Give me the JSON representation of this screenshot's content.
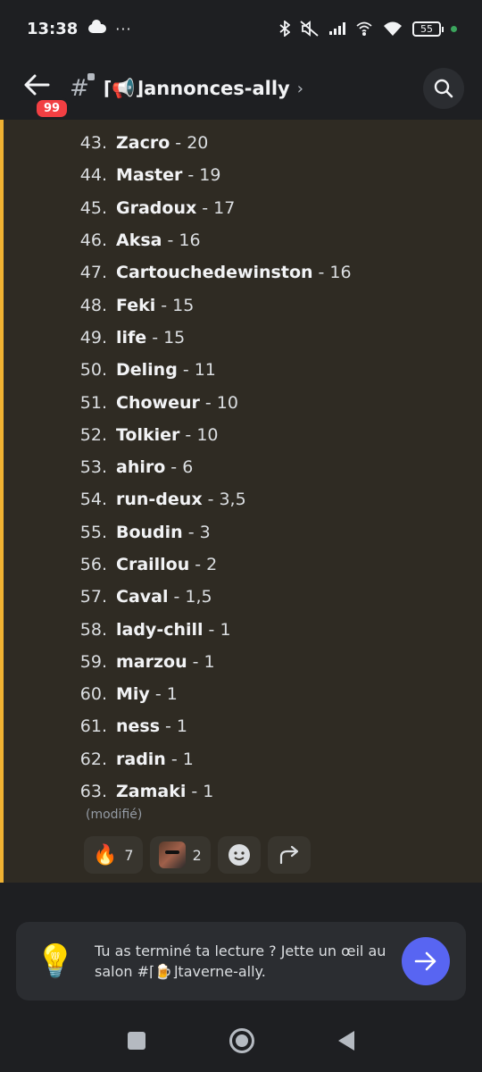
{
  "status_bar": {
    "time": "13:38",
    "dots": "···",
    "battery": "55"
  },
  "header": {
    "badge": "99",
    "channel": "⌈📢⌋annonces-ally",
    "chevron": "›"
  },
  "ranking": [
    {
      "rank": "43.",
      "name": "Zacro",
      "score": "- 20"
    },
    {
      "rank": "44.",
      "name": "Master",
      "score": "- 19"
    },
    {
      "rank": "45.",
      "name": "Gradoux",
      "score": "- 17"
    },
    {
      "rank": "46.",
      "name": "Aksa",
      "score": "- 16"
    },
    {
      "rank": "47.",
      "name": "Cartouchedewinston",
      "score": "- 16"
    },
    {
      "rank": "48.",
      "name": "Feki",
      "score": "- 15"
    },
    {
      "rank": "49.",
      "name": "life",
      "score": "- 15"
    },
    {
      "rank": "50.",
      "name": "Deling",
      "score": "- 11"
    },
    {
      "rank": "51.",
      "name": "Choweur",
      "score": "- 10"
    },
    {
      "rank": "52.",
      "name": "Tolkier",
      "score": "- 10"
    },
    {
      "rank": "53.",
      "name": "ahiro",
      "score": "- 6"
    },
    {
      "rank": "54.",
      "name": "run-deux",
      "score": "- 3,5"
    },
    {
      "rank": "55.",
      "name": "Boudin",
      "score": "- 3"
    },
    {
      "rank": "56.",
      "name": "Craillou",
      "score": "- 2"
    },
    {
      "rank": "57.",
      "name": "Caval",
      "score": "- 1,5"
    },
    {
      "rank": "58.",
      "name": "lady-chill",
      "score": "- 1"
    },
    {
      "rank": "59.",
      "name": "marzou",
      "score": "- 1"
    },
    {
      "rank": "60.",
      "name": "Miy",
      "score": "- 1"
    },
    {
      "rank": "61.",
      "name": "ness",
      "score": "- 1"
    },
    {
      "rank": "62.",
      "name": "radin",
      "score": "- 1"
    },
    {
      "rank": "63.",
      "name": "Zamaki",
      "score": "- 1"
    }
  ],
  "edited_label": "(modifié)",
  "reactions": {
    "fire_emoji": "🔥",
    "fire_count": "7",
    "avatar_count": "2"
  },
  "card": {
    "text": "Tu as terminé ta lecture ? Jette un œil au salon #⌈🍺⌋taverne-ally.",
    "emoji": "💡"
  },
  "colors": {
    "accent_bar": "#f0b232",
    "message_bg": "#2f2b23",
    "button": "#5865f2",
    "badge": "#f23f43"
  }
}
